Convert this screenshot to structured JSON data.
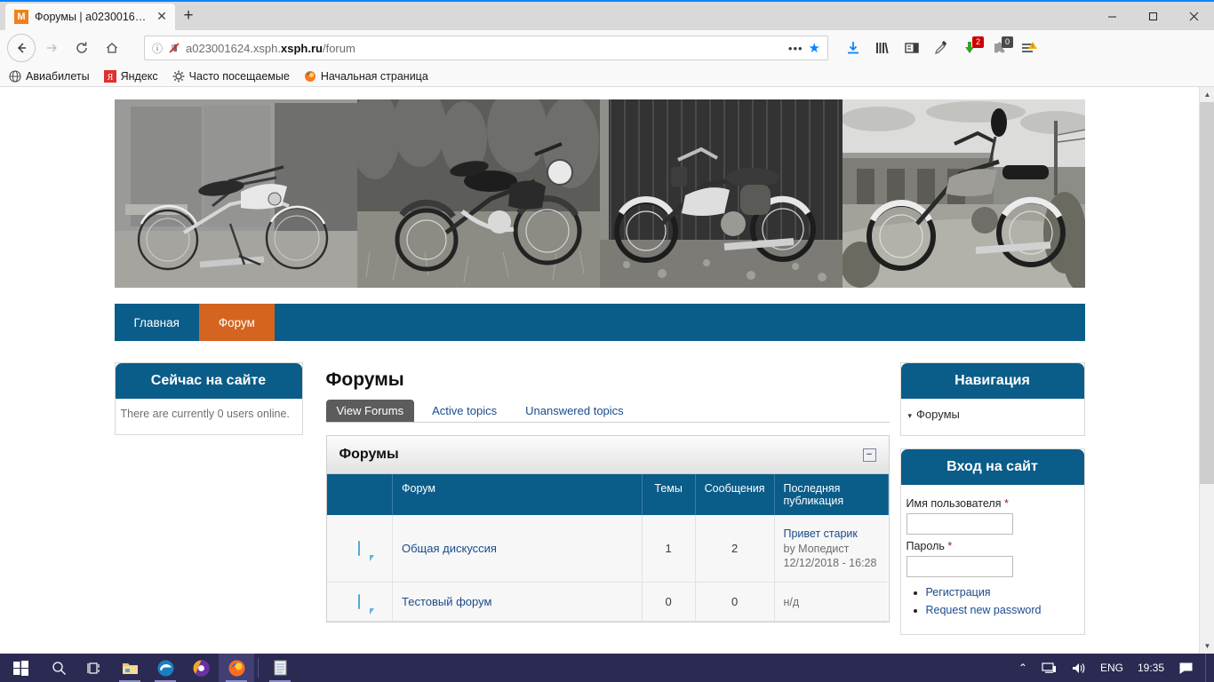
{
  "browser": {
    "tab": {
      "title": "Форумы | a023001624.xsph",
      "favicon_letter": "M",
      "close_icon": "close-icon"
    },
    "newtab_label": "+",
    "window_controls": {
      "minimize": "—",
      "maximize": "❐",
      "close": "✕"
    },
    "nav": {
      "back": "←",
      "forward": "→",
      "reload": "⟳",
      "home": "⌂"
    },
    "url": {
      "prefix": "a023001624.xsph.",
      "bold": "xsph.ru",
      "suffix": "/forum",
      "full": "a023001624.xsph.xsph.ru/forum",
      "info_icon": "info-icon",
      "mixed_content_icon": "broken-lock-icon",
      "menu_dots": "•••",
      "bookmark_star": "★"
    },
    "toolbar_icons": [
      {
        "name": "downloads-icon",
        "badge": ""
      },
      {
        "name": "library-icon",
        "badge": ""
      },
      {
        "name": "sidebar-icon",
        "badge": ""
      },
      {
        "name": "eyedropper-icon",
        "badge": ""
      },
      {
        "name": "download-helper-icon",
        "badge": "2",
        "badge_color": "#cc0000"
      },
      {
        "name": "puzzle-extension-icon",
        "badge": "0",
        "badge_color": "#4a4a4a"
      },
      {
        "name": "hamburger-menu-icon",
        "badge": ""
      }
    ],
    "bookmarks": [
      {
        "label": "Авиабилеты",
        "icon": "globe-icon"
      },
      {
        "label": "Яндекс",
        "icon": "yandex-icon"
      },
      {
        "label": "Часто посещаемые",
        "icon": "gear-icon"
      },
      {
        "label": "Начальная страница",
        "icon": "firefox-icon"
      }
    ]
  },
  "site": {
    "banner": {
      "alt": "moped-photos-banner",
      "image_count": 4
    },
    "menu": [
      {
        "label": "Главная",
        "active": false
      },
      {
        "label": "Форум",
        "active": true
      }
    ],
    "left_block": {
      "title": "Сейчас на сайте",
      "text": "There are currently 0 users online."
    },
    "main": {
      "page_title": "Форумы",
      "tabs": [
        {
          "label": "View Forums",
          "active": true
        },
        {
          "label": "Active topics",
          "active": false
        },
        {
          "label": "Unanswered topics",
          "active": false
        }
      ],
      "panel_title": "Форумы",
      "collapse_icon": "−",
      "table": {
        "headers": [
          "",
          "Форум",
          "Темы",
          "Сообщения",
          "Последняя публикация"
        ],
        "rows": [
          {
            "icon": "forum-bubble-icon",
            "name": "Общая дискуссия",
            "topics": "1",
            "posts": "2",
            "last_title": "Привет старик",
            "last_by": "by Мопедист",
            "last_date": "12/12/2018 - 16:28",
            "last_empty": ""
          },
          {
            "icon": "forum-bubble-icon",
            "name": "Тестовый форум",
            "topics": "0",
            "posts": "0",
            "last_title": "",
            "last_by": "",
            "last_date": "",
            "last_empty": "н/д"
          }
        ]
      }
    },
    "right_nav": {
      "title": "Навигация",
      "items": [
        {
          "label": "Форумы",
          "caret": "▾"
        }
      ]
    },
    "login": {
      "title": "Вход на сайт",
      "username_label": "Имя пользователя",
      "username_value": "",
      "password_label": "Пароль",
      "password_value": "",
      "required_mark": "*",
      "links": [
        {
          "label": "Регистрация"
        },
        {
          "label": "Request new password"
        }
      ]
    }
  },
  "taskbar": {
    "items": [
      {
        "name": "start-button",
        "icon": "windows-logo-icon"
      },
      {
        "name": "search-button",
        "icon": "search-icon"
      },
      {
        "name": "task-view-button",
        "icon": "task-view-icon"
      },
      {
        "name": "file-explorer-button",
        "icon": "folder-icon"
      },
      {
        "name": "edge-button",
        "icon": "edge-icon"
      },
      {
        "name": "browser-button",
        "icon": "purple-circle-icon"
      },
      {
        "name": "firefox-button",
        "icon": "firefox-icon"
      },
      {
        "name": "notepad-button",
        "icon": "notepad-icon"
      }
    ],
    "tray": {
      "chevron": "⌃",
      "network_icon": "network-icon",
      "volume_icon": "volume-icon",
      "language": "ENG",
      "clock": "19:35",
      "action_center_icon": "notifications-icon"
    }
  },
  "colors": {
    "accent_teal": "#0a5c89",
    "accent_orange": "#d4641f",
    "link": "#1a4b8c",
    "taskbar": "#2b2a52"
  }
}
